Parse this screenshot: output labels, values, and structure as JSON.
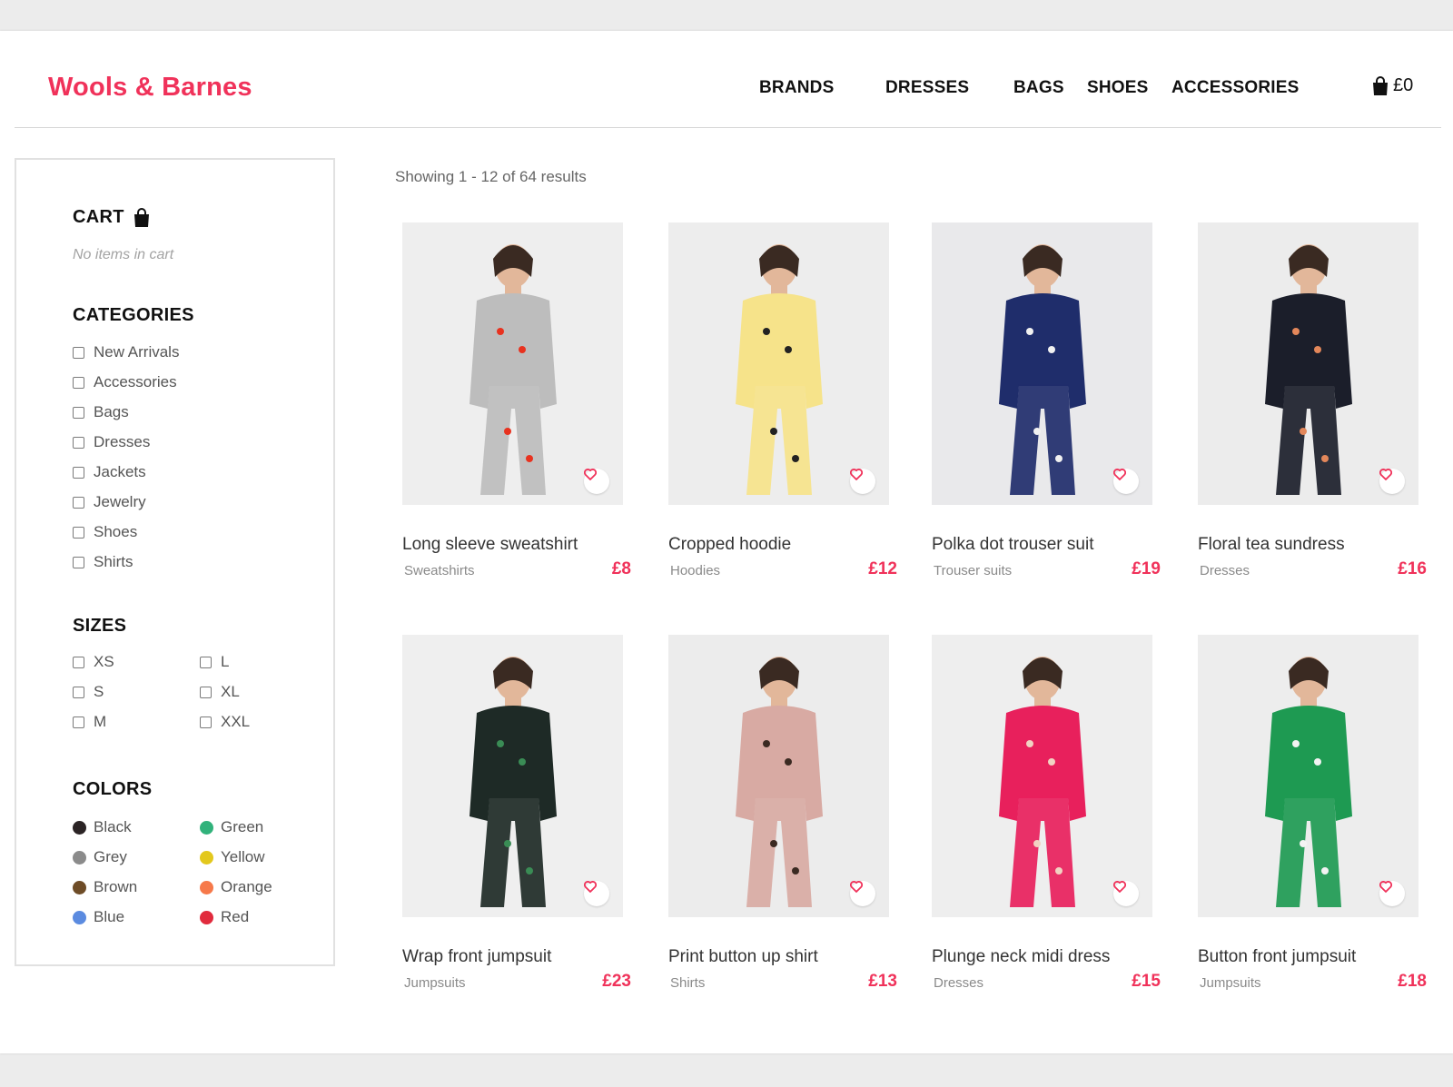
{
  "brand": {
    "name": "Wools & Barnes",
    "color": "#f0325a"
  },
  "nav": {
    "items": [
      {
        "label": "BRANDS",
        "name": "nav-brands"
      },
      {
        "label": "DRESSES",
        "name": "nav-dresses"
      },
      {
        "label": "BAGS",
        "name": "nav-bags"
      },
      {
        "label": "SHOES",
        "name": "nav-shoes"
      },
      {
        "label": "ACCESSORIES",
        "name": "nav-accessories"
      }
    ],
    "cart_total": "£0",
    "cart_icon": "shopping-bag-icon"
  },
  "sidebar": {
    "cart": {
      "heading": "CART",
      "icon": "shopping-bag-icon",
      "empty_text": "No items in cart"
    },
    "categories": {
      "heading": "CATEGORIES",
      "items": [
        "New Arrivals",
        "Accessories",
        "Bags",
        "Dresses",
        "Jackets",
        "Jewelry",
        "Shoes",
        "Shirts"
      ]
    },
    "sizes": {
      "heading": "SIZES",
      "items": [
        "XS",
        "S",
        "M",
        "L",
        "XL",
        "XXL"
      ]
    },
    "colors": {
      "heading": "COLORS",
      "items": [
        {
          "label": "Black",
          "hex": "#2b2425"
        },
        {
          "label": "Grey",
          "hex": "#8b8b8b"
        },
        {
          "label": "Brown",
          "hex": "#6e4c27"
        },
        {
          "label": "Blue",
          "hex": "#5b8be0"
        },
        {
          "label": "Green",
          "hex": "#31b27b"
        },
        {
          "label": "Yellow",
          "hex": "#e3c81d"
        },
        {
          "label": "Orange",
          "hex": "#f6794a"
        },
        {
          "label": "Red",
          "hex": "#e12b3d"
        }
      ]
    }
  },
  "main": {
    "results_text": "Showing 1 - 12 of 64 results",
    "heart_icon": "heart-icon",
    "products": [
      {
        "title": "Long sleeve sweatshirt",
        "category": "Sweatshirts",
        "price": "£8",
        "bg": "#eeeeee",
        "garment": "#bdbdbd",
        "accent": "#e8321f"
      },
      {
        "title": "Cropped hoodie",
        "category": "Hoodies",
        "price": "£12",
        "bg": "#ededed",
        "garment": "#f6e38a",
        "accent": "#222222"
      },
      {
        "title": "Polka dot trouser suit",
        "category": "Trouser suits",
        "price": "£19",
        "bg": "#e9e9eb",
        "garment": "#1f2d6b",
        "accent": "#f1f1f1"
      },
      {
        "title": "Floral tea sundress",
        "category": "Dresses",
        "price": "£16",
        "bg": "#ececec",
        "garment": "#1b1e2a",
        "accent": "#e3875a"
      },
      {
        "title": "Wrap front jumpsuit",
        "category": "Jumpsuits",
        "price": "£23",
        "bg": "#efefef",
        "garment": "#1e2a26",
        "accent": "#3a8c55"
      },
      {
        "title": "Print button up shirt",
        "category": "Shirts",
        "price": "£13",
        "bg": "#ececec",
        "garment": "#d8aaa3",
        "accent": "#3b2a22"
      },
      {
        "title": "Plunge neck midi dress",
        "category": "Dresses",
        "price": "£15",
        "bg": "#eeeeee",
        "garment": "#e8205c",
        "accent": "#f1d2c2"
      },
      {
        "title": "Button front jumpsuit",
        "category": "Jumpsuits",
        "price": "£18",
        "bg": "#ededed",
        "garment": "#1e9a52",
        "accent": "#f3f3f3"
      }
    ]
  }
}
